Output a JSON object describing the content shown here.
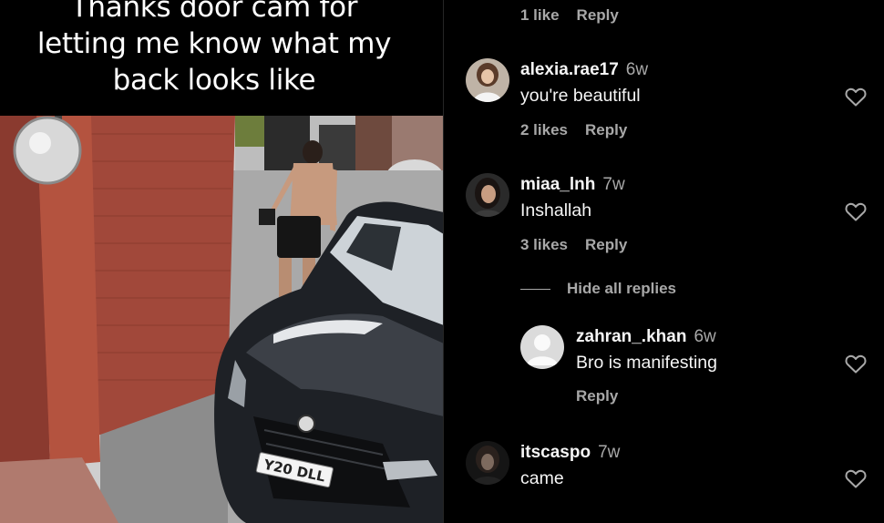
{
  "post": {
    "caption": "Thanks door cam for\nletting me know what my\nback looks like",
    "plate_text": "Y20 DLL"
  },
  "comments": {
    "top": {
      "likes": "1 like",
      "reply": "Reply"
    },
    "items": [
      {
        "username": "alexia.rae17",
        "time": "6w",
        "text": "you're beautiful",
        "likes": "2 likes",
        "reply": "Reply"
      },
      {
        "username": "miaa_lnh",
        "time": "7w",
        "text": "Inshallah",
        "likes": "3 likes",
        "reply": "Reply"
      },
      {
        "username": "itscaspo",
        "time": "7w",
        "text": "came"
      }
    ],
    "hide_replies": "Hide all replies",
    "reply": {
      "username": "zahran_.khan",
      "time": "6w",
      "text": "Bro is manifesting",
      "reply": "Reply"
    }
  }
}
